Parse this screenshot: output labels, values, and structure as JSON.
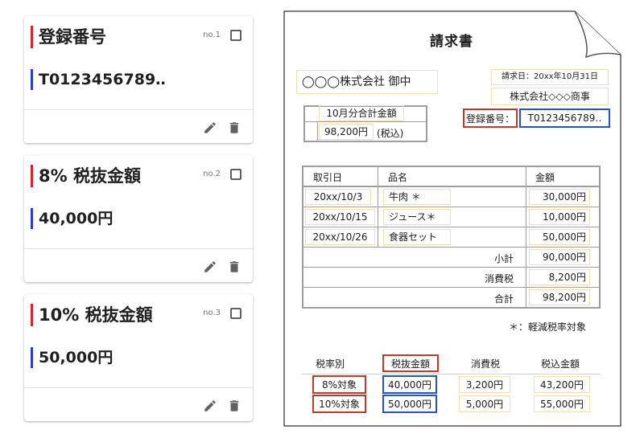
{
  "cards": [
    {
      "title": "登録番号",
      "no": "no.1",
      "value": "T0123456789‥"
    },
    {
      "title": "8% 税抜金額",
      "no": "no.2",
      "value": "40,000円"
    },
    {
      "title": "10% 税抜金額",
      "no": "no.3",
      "value": "50,000円"
    }
  ],
  "invoice": {
    "title": "請求書",
    "recipient": "◯◯◯株式会社 御中",
    "date": "請求日：20xx年10月31日",
    "issuer": "株式会社◇◇◇商事",
    "total_label": "10月分合計金額",
    "total_value": "98,200円",
    "total_note": "(税込)",
    "reg_label": "登録番号：",
    "reg_value": "T0123456789‥",
    "table": {
      "headers": [
        "取引日",
        "品名",
        "金額"
      ],
      "rows": [
        {
          "date": "20xx/10/3",
          "item": "牛肉 ＊",
          "amount": "30,000円"
        },
        {
          "date": "20xx/10/15",
          "item": "ジュース＊",
          "amount": "10,000円"
        },
        {
          "date": "20xx/10/26",
          "item": "食器セット",
          "amount": "50,000円"
        }
      ],
      "summary": [
        {
          "label": "小計",
          "value": "90,000円"
        },
        {
          "label": "消費税",
          "value": "8,200円"
        },
        {
          "label": "合計",
          "value": "98,200円"
        }
      ]
    },
    "footnote": "＊：軽減税率対象",
    "tax_table": {
      "headers": [
        "税率別",
        "税抜金額",
        "消費税",
        "税込金額"
      ],
      "rows": [
        {
          "rate": "8%対象",
          "base": "40,000円",
          "tax": "3,200円",
          "total": "43,200円"
        },
        {
          "rate": "10%対象",
          "base": "50,000円",
          "tax": "5,000円",
          "total": "55,000円"
        }
      ]
    }
  },
  "colors": {
    "red": "#c0392b",
    "blue": "#2156c8",
    "yellow": "#f3ddb3"
  },
  "icons": {
    "edit": "pencil-icon",
    "delete": "trash-icon",
    "select": "checkbox-icon"
  }
}
